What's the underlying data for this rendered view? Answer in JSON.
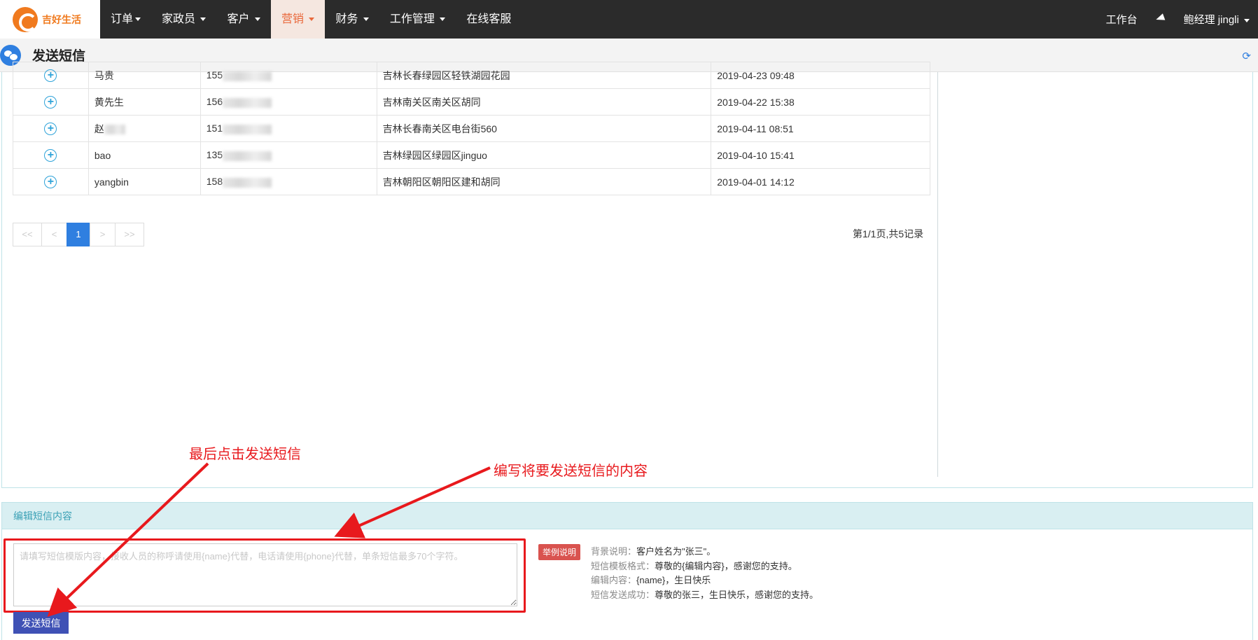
{
  "brand": {
    "name": "吉好生活",
    "color": "#f07a1e"
  },
  "nav": {
    "items": [
      {
        "label": "订单",
        "dropdown": true
      },
      {
        "label": "家政员",
        "dropdown": true
      },
      {
        "label": "客户",
        "dropdown": true
      },
      {
        "label": "营销",
        "dropdown": true,
        "active": true
      },
      {
        "label": "财务",
        "dropdown": true
      },
      {
        "label": "工作管理",
        "dropdown": true
      },
      {
        "label": "在线客服",
        "dropdown": false
      }
    ],
    "workbench": "工作台",
    "user": "鲍经理 jingli"
  },
  "page": {
    "title": "发送短信"
  },
  "table": {
    "rows": [
      {
        "name": "马贵",
        "phone": "155",
        "address": "吉林长春绿园区轻铁湖园花园",
        "date": "2019-04-23 09:48"
      },
      {
        "name": "黄先生",
        "phone": "156",
        "address": "吉林南关区南关区胡同",
        "date": "2019-04-22 15:38"
      },
      {
        "name": "赵",
        "phone": "151",
        "address": "吉林长春南关区电台街560",
        "date": "2019-04-11 08:51"
      },
      {
        "name": "bao",
        "phone": "135",
        "address": "吉林绿园区绿园区jinguo",
        "date": "2019-04-10 15:41"
      },
      {
        "name": "yangbin",
        "phone": "158",
        "address": "吉林朝阳区朝阳区建和胡同",
        "date": "2019-04-01 14:12"
      }
    ]
  },
  "pager": {
    "first": "<<",
    "prev": "<",
    "current": "1",
    "next": ">",
    "last": ">>",
    "info": "第1/1页,共5记录"
  },
  "sms": {
    "panel_title": "编辑短信内容",
    "placeholder": "请填写短信模版内容，接收人员的称呼请使用{name}代替，电话请使用{phone}代替，单条短信最多70个字符。",
    "send_label": "发送短信",
    "example_badge": "举例说明",
    "examples": [
      {
        "k": "背景说明：",
        "v": "客户姓名为\"张三\"。"
      },
      {
        "k": "短信模板格式：",
        "v": "尊敬的{编辑内容}，感谢您的支持。"
      },
      {
        "k": "编辑内容：",
        "v": "{name}，生日快乐"
      },
      {
        "k": "短信发送成功：",
        "v": "尊敬的张三，生日快乐，感谢您的支持。"
      }
    ]
  },
  "annotations": {
    "click_send": "最后点击发送短信",
    "write_content": "编写将要发送短信的内容",
    "color": "#e8191d"
  }
}
